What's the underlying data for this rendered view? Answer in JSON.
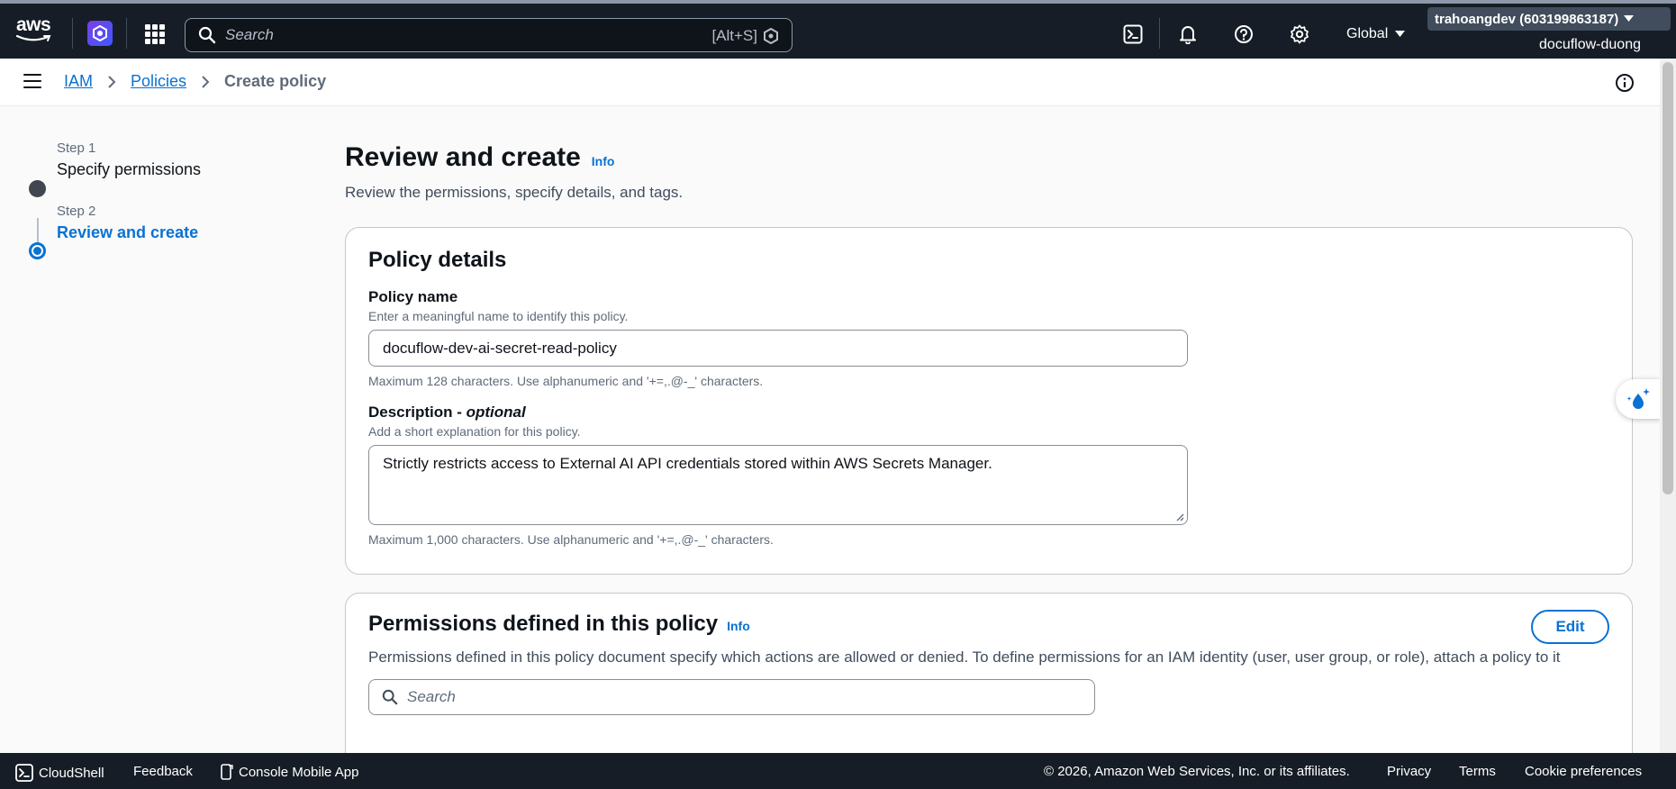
{
  "topnav": {
    "logo_text": "aws",
    "search_placeholder": "Search",
    "search_shortcut": "[Alt+S]",
    "region": "Global",
    "account": "trahoangdev (603199863187)",
    "role": "docuflow-duong",
    "icons": [
      "cloudshell-icon",
      "bell-icon",
      "help-icon",
      "settings-icon"
    ]
  },
  "breadcrumb": {
    "items": [
      "IAM",
      "Policies"
    ],
    "current": "Create policy"
  },
  "steps": [
    {
      "label": "Step 1",
      "title": "Specify permissions",
      "state": "completed"
    },
    {
      "label": "Step 2",
      "title": "Review and create",
      "state": "current"
    }
  ],
  "page": {
    "title": "Review and create",
    "info": "Info",
    "subtitle": "Review the permissions, specify details, and tags."
  },
  "policy_details": {
    "heading": "Policy details",
    "name_label": "Policy name",
    "name_desc": "Enter a meaningful name to identify this policy.",
    "name_value": "docuflow-dev-ai-secret-read-policy",
    "name_constraint": "Maximum 128 characters. Use alphanumeric and '+=,.@-_' characters.",
    "desc_label": "Description - ",
    "desc_optional": "optional",
    "desc_desc": "Add a short explanation for this policy.",
    "desc_value": "Strictly restricts access to External AI API credentials stored within AWS Secrets Manager.",
    "desc_constraint": "Maximum 1,000 characters. Use alphanumeric and '+=,.@-_' characters."
  },
  "permissions": {
    "heading": "Permissions defined in this policy",
    "info": "Info",
    "edit": "Edit",
    "description": "Permissions defined in this policy document specify which actions are allowed or denied. To define permissions for an IAM identity (user, user group, or role), attach a policy to it",
    "search_placeholder": "Search"
  },
  "footer": {
    "cloudshell": "CloudShell",
    "feedback": "Feedback",
    "mobile_app": "Console Mobile App",
    "copyright": "© 2026, Amazon Web Services, Inc. or its affiliates.",
    "privacy": "Privacy",
    "terms": "Terms",
    "cookies": "Cookie preferences"
  },
  "colors": {
    "nav_bg": "#161d26",
    "link": "#0972d3",
    "step_completed": "#424650",
    "step_current": "#0972d3"
  }
}
